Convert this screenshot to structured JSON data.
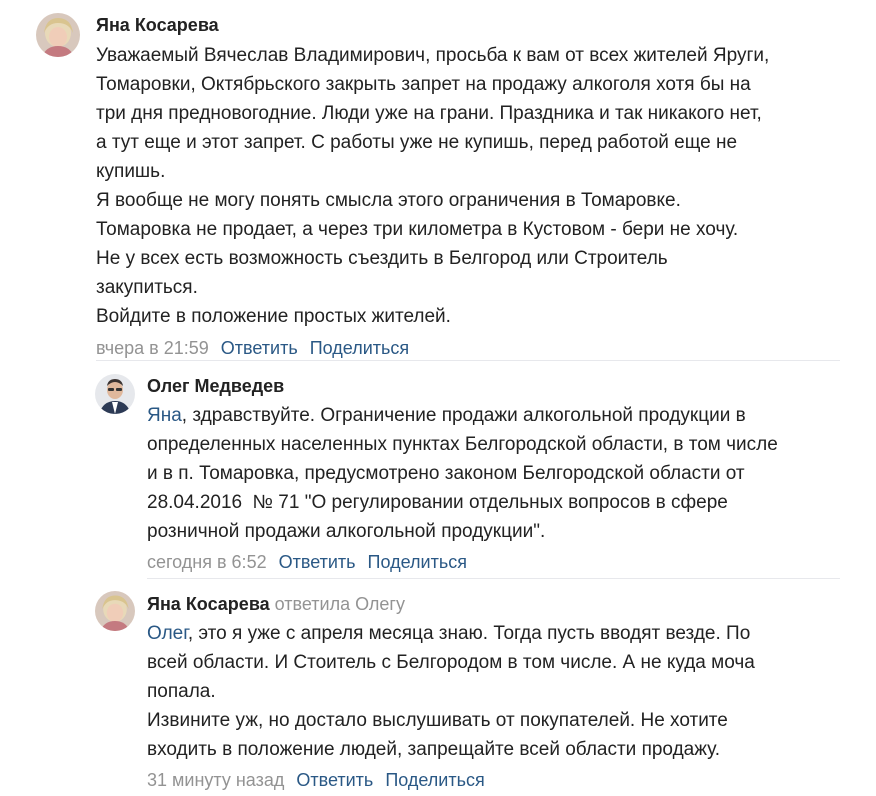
{
  "comments": [
    {
      "author": "Яна Косарева",
      "lines": [
        "Уважаемый Вячеслав Владимирович, просьба к вам от всех жителей Яруги,",
        "Томаровки, Октябрьского закрыть запрет на продажу алкоголя хотя бы на",
        "три дня предновогодние. Люди уже на грани. Праздника и так никакого нет,",
        "а тут еще и этот запрет. С работы уже не купишь, перед работой еще не",
        "купишь.",
        "Я вообще не могу понять смысла этого ограничения в Томаровке.",
        "Томаровка не продает, а через три километра в Кустовом - бери не хочу.",
        "Не у всех есть возможность съездить в Белгород или Строитель",
        "закупиться.",
        "Войдите в положение простых жителей."
      ],
      "time": "вчера в 21:59",
      "reply_label": "Ответить",
      "share_label": "Поделиться"
    },
    {
      "author": "Олег Медведев",
      "mention": "Яна",
      "first_line_rest": ", здравствуйте. Ограничение продажи алкогольной продукции в",
      "lines": [
        "определенных населенных пунктах Белгородской области, в том числе",
        "и в п. Томаровка, предусмотрено законом Белгородской области от",
        "28.04.2016  № 71 \"О регулировании отдельных вопросов в сфере",
        "розничной продажи алкогольной продукции\"."
      ],
      "time": "сегодня в 6:52",
      "reply_label": "Ответить",
      "share_label": "Поделиться"
    },
    {
      "author": "Яна Косарева",
      "reply_to": "ответила Олегу",
      "mention": "Олег",
      "first_line_rest": ", это я уже с апреля месяца знаю. Тогда пусть вводят везде. По",
      "lines": [
        "всей области. И Стоитель с Белгородом в том числе. А не куда моча",
        "попала.",
        "Извините уж, но достало выслушивать от покупателей. Не хотите",
        "входить в положение людей, запрещайте всей области продажу."
      ],
      "time": "31 минуту назад",
      "reply_label": "Ответить",
      "share_label": "Поделиться"
    }
  ]
}
